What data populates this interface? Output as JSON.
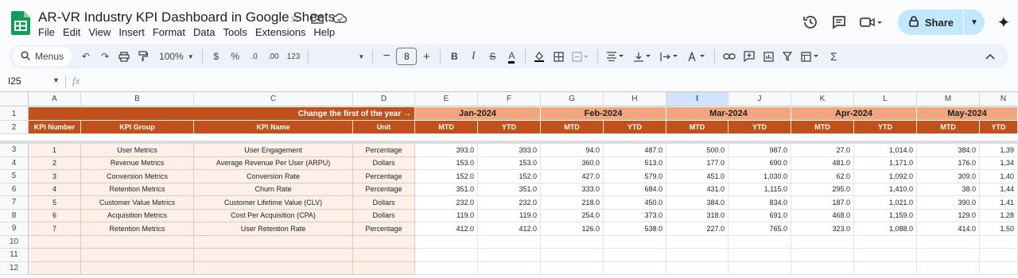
{
  "doc": {
    "title": "AR-VR Industry KPI Dashboard in Google Sheets",
    "menus": [
      "File",
      "Edit",
      "View",
      "Insert",
      "Format",
      "Data",
      "Tools",
      "Extensions",
      "Help"
    ],
    "share_label": "Share"
  },
  "toolbar": {
    "menus_label": "Menus",
    "zoom": "100%",
    "currency": "$",
    "percent": "%",
    "dec_decrease": ".0",
    "dec_increase": ".00",
    "number_format": "123",
    "font_size": "8",
    "bold": "B",
    "italic": "I",
    "strike": "S",
    "text_color": "A"
  },
  "formula_bar": {
    "name_box": "I25",
    "fx": "fx"
  },
  "grid": {
    "columns": [
      "A",
      "B",
      "C",
      "D",
      "E",
      "F",
      "G",
      "H",
      "I",
      "J",
      "K",
      "L",
      "M",
      "N"
    ],
    "selected_column": "I",
    "row_numbers": [
      "1",
      "2",
      "3",
      "4",
      "5",
      "6",
      "7",
      "8",
      "9",
      "10",
      "11",
      "12"
    ],
    "banner": "Change the first of the year →",
    "months": [
      "Jan-2024",
      "Feb-2024",
      "Mar-2024",
      "Apr-2024",
      "May-2024"
    ],
    "headers": [
      "KPI Number",
      "KPI Group",
      "KPI Name",
      "Unit"
    ],
    "sub_headers": [
      "MTD",
      "YTD"
    ],
    "rows": [
      {
        "num": "1",
        "group": "User Metrics",
        "name": "User Engagement",
        "unit": "Percentage",
        "values": [
          "393.0",
          "393.0",
          "94.0",
          "487.0",
          "500.0",
          "987.0",
          "27.0",
          "1,014.0",
          "384.0",
          "1,39"
        ]
      },
      {
        "num": "2",
        "group": "Revenue Metrics",
        "name": "Average Revenue Per User (ARPU)",
        "unit": "Dollars",
        "values": [
          "153.0",
          "153.0",
          "360.0",
          "513.0",
          "177.0",
          "690.0",
          "481.0",
          "1,171.0",
          "176.0",
          "1,34"
        ]
      },
      {
        "num": "3",
        "group": "Conversion Metrics",
        "name": "Conversion Rate",
        "unit": "Percentage",
        "values": [
          "152.0",
          "152.0",
          "427.0",
          "579.0",
          "451.0",
          "1,030.0",
          "62.0",
          "1,092.0",
          "309.0",
          "1,40"
        ]
      },
      {
        "num": "4",
        "group": "Retention Metrics",
        "name": "Churn Rate",
        "unit": "Percentage",
        "values": [
          "351.0",
          "351.0",
          "333.0",
          "684.0",
          "431.0",
          "1,115.0",
          "295.0",
          "1,410.0",
          "38.0",
          "1,44"
        ]
      },
      {
        "num": "5",
        "group": "Customer Value Metrics",
        "name": "Customer Lifetime Value (CLV)",
        "unit": "Dollars",
        "values": [
          "232.0",
          "232.0",
          "218.0",
          "450.0",
          "384.0",
          "834.0",
          "187.0",
          "1,021.0",
          "390.0",
          "1,41"
        ]
      },
      {
        "num": "6",
        "group": "Acquisition Metrics",
        "name": "Cost Per Acquisition (CPA)",
        "unit": "Dollars",
        "values": [
          "119.0",
          "119.0",
          "254.0",
          "373.0",
          "318.0",
          "691.0",
          "468.0",
          "1,159.0",
          "129.0",
          "1,28"
        ]
      },
      {
        "num": "7",
        "group": "Retention Metrics",
        "name": "User Retention Rate",
        "unit": "Percentage",
        "values": [
          "412.0",
          "412.0",
          "126.0",
          "538.0",
          "227.0",
          "765.0",
          "323.0",
          "1,088.0",
          "414.0",
          "1,50"
        ]
      }
    ]
  },
  "colors": {
    "header_dark": "#c0501c",
    "header_light": "#f2a67f",
    "band": "#fdf0e9",
    "share_bg": "#c2e7ff"
  }
}
